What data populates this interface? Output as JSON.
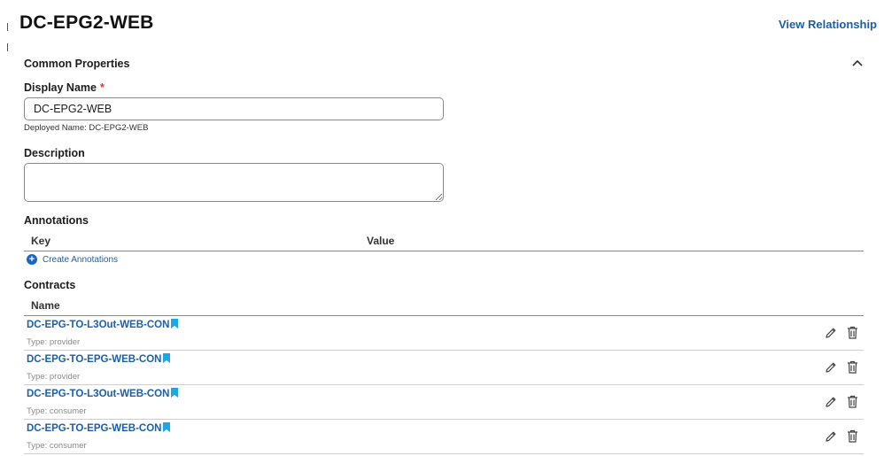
{
  "header": {
    "title": "DC-EPG2-WEB",
    "view_relationship": "View Relationship"
  },
  "common_properties": {
    "title": "Common Properties",
    "display_name": {
      "label": "Display Name",
      "required_mark": "*",
      "value": "DC-EPG2-WEB",
      "deployed_name": "Deployed Name: DC-EPG2-WEB"
    },
    "description": {
      "label": "Description",
      "value": ""
    }
  },
  "annotations": {
    "title": "Annotations",
    "columns": [
      "Key",
      "Value"
    ],
    "create_label": "Create Annotations"
  },
  "contracts": {
    "title": "Contracts",
    "column": "Name",
    "rows": [
      {
        "name": "DC-EPG-TO-L3Out-WEB-CON",
        "type": "Type: provider"
      },
      {
        "name": "DC-EPG-TO-EPG-WEB-CON",
        "type": "Type: provider"
      },
      {
        "name": "DC-EPG-TO-L3Out-WEB-CON",
        "type": "Type: consumer"
      },
      {
        "name": "DC-EPG-TO-EPG-WEB-CON",
        "type": "Type: consumer"
      }
    ]
  },
  "icons": {
    "collapse": "chevron-up-icon",
    "create": "plus-circle-icon",
    "bookmark": "bookmark-icon",
    "edit": "pencil-icon",
    "delete": "trash-icon"
  },
  "colors": {
    "link": "#1b5fa8",
    "bookmark": "#1ea6e8",
    "required": "#d43a3a",
    "plus": "#1b66c4"
  }
}
